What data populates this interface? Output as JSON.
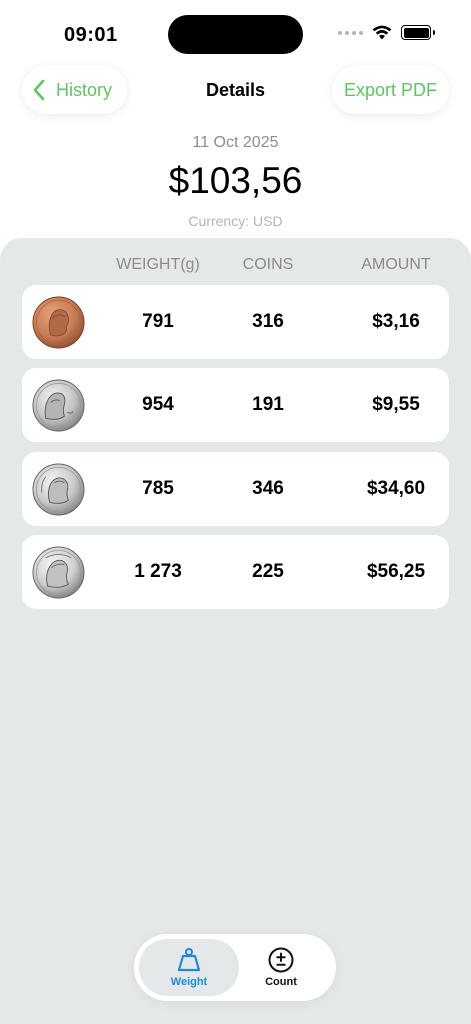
{
  "status_bar": {
    "time": "09:01"
  },
  "nav": {
    "back_label": "History",
    "title": "Details",
    "export_label": "Export PDF"
  },
  "summary": {
    "date": "11 Oct 2025",
    "total": "$103,56",
    "currency": "Currency: USD"
  },
  "table": {
    "headers": {
      "weight": "WEIGHT(g)",
      "coins": "COINS",
      "amount": "AMOUNT"
    },
    "rows": [
      {
        "coin": "penny",
        "weight": "791",
        "coins": "316",
        "amount": "$3,16"
      },
      {
        "coin": "nickel",
        "weight": "954",
        "coins": "191",
        "amount": "$9,55"
      },
      {
        "coin": "dime",
        "weight": "785",
        "coins": "346",
        "amount": "$34,60"
      },
      {
        "coin": "quarter",
        "weight": "1 273",
        "coins": "225",
        "amount": "$56,25"
      }
    ]
  },
  "tabs": [
    {
      "label": "Weight",
      "icon": "weight-icon",
      "active": true
    },
    {
      "label": "Count",
      "icon": "plus-minus-icon",
      "active": false
    }
  ],
  "colors": {
    "accent_green": "#5ac85e",
    "accent_blue": "#1e88e5",
    "panel_bg": "#e5e8e9"
  }
}
